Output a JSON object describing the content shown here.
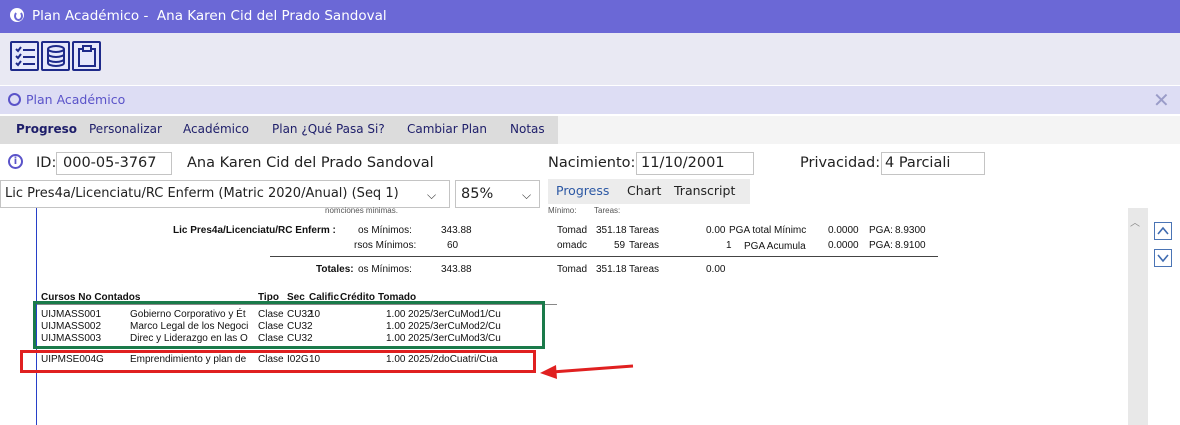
{
  "window": {
    "title": "Plan Académico -  Ana Karen Cid del Prado Sandoval"
  },
  "toolbar": {
    "icons": [
      "checklist-icon",
      "database-icon",
      "clipboard-icon"
    ]
  },
  "panel": {
    "title": "Plan Académico"
  },
  "nav": {
    "items": [
      "Progreso",
      "Personalizar",
      "Académico",
      "Plan ¿Qué Pasa Si?",
      "Cambiar Plan",
      "Notas"
    ],
    "active": "Progreso"
  },
  "student": {
    "id_label": "ID:",
    "id_value": "000-05-3767",
    "name": "Ana Karen Cid del Prado Sandoval",
    "birth_label": "Nacimiento:",
    "birth_value": "11/10/2001",
    "privacy_label": "Privacidad:",
    "privacy_value": "4 Parciali"
  },
  "plan_select": {
    "value": "Lic Pres4a/Licenciatu/RC Enferm (Matric 2020/Anual) (Seq 1)"
  },
  "zoom_select": {
    "value": "85%"
  },
  "view_tabs": {
    "items": [
      "Progress",
      "Chart",
      "Transcript"
    ],
    "active": "Progress"
  },
  "report": {
    "top_partial": [
      "nomciones minimas.",
      "Mínimo:",
      "Tareas:"
    ],
    "plan_row": {
      "name": "Lic Pres4a/Licenciatu/RC Enferm :",
      "credits_label": "os Mínimos:",
      "credits_min": "343.88",
      "taken_label": "Tomad",
      "taken_value": "351.18",
      "tasks_label": "Tareas",
      "tasks_value": "0.00",
      "pga_total_label": "PGA total Mínimc",
      "pga_total_min": "0.0000",
      "pga_label": "PGA:",
      "pga_value": "8.9300"
    },
    "courses_row": {
      "courses_label": "rsos Mínimos:",
      "courses_min": "60",
      "taken_label": "omadc",
      "taken_value": "59",
      "tasks_label": "Tareas",
      "tasks_value": "1",
      "pga_acc_label": "PGA Acumula",
      "pga_acc_min": "0.0000",
      "pga_label": "PGA:",
      "pga_value": "8.9100"
    },
    "totals_row": {
      "label": "Totales:",
      "credits_label": "os Mínimos:",
      "credits_min": "343.88",
      "taken_label": "Tomad",
      "taken_value": "351.18",
      "tasks_label": "Tareas",
      "tasks_value": "0.00"
    },
    "not_counted": {
      "headers": [
        "Cursos No Contados",
        "Tipo",
        "Sec",
        "Calific",
        "Crédito",
        "Tomado"
      ],
      "rows": [
        [
          "UIJMASS001",
          "Gobierno Corporativo y Ét",
          "Clase",
          "CU32",
          "10",
          "1.00",
          "2025/3erCuMod1/Cu"
        ],
        [
          "UIJMASS002",
          "Marco Legal de los Negoci",
          "Clase",
          "CU32",
          "",
          "1.00",
          "2025/3erCuMod2/Cu"
        ],
        [
          "UIJMASS003",
          "Direc y Liderazgo en las O",
          "Clase",
          "CU32",
          "",
          "1.00",
          "2025/3erCuMod3/Cu"
        ],
        [
          "UIPMSE004G",
          "Emprendimiento y plan de",
          "Clase",
          "I02G",
          "10",
          "1.00",
          "2025/2doCuatri/Cua"
        ]
      ]
    }
  },
  "annotations": {
    "green_box": "#1a7a4a",
    "red_box": "#e02020",
    "arrow": "#e02020"
  },
  "colors": {
    "titlebar": "#6b68d6",
    "accent": "#5a53c9"
  }
}
